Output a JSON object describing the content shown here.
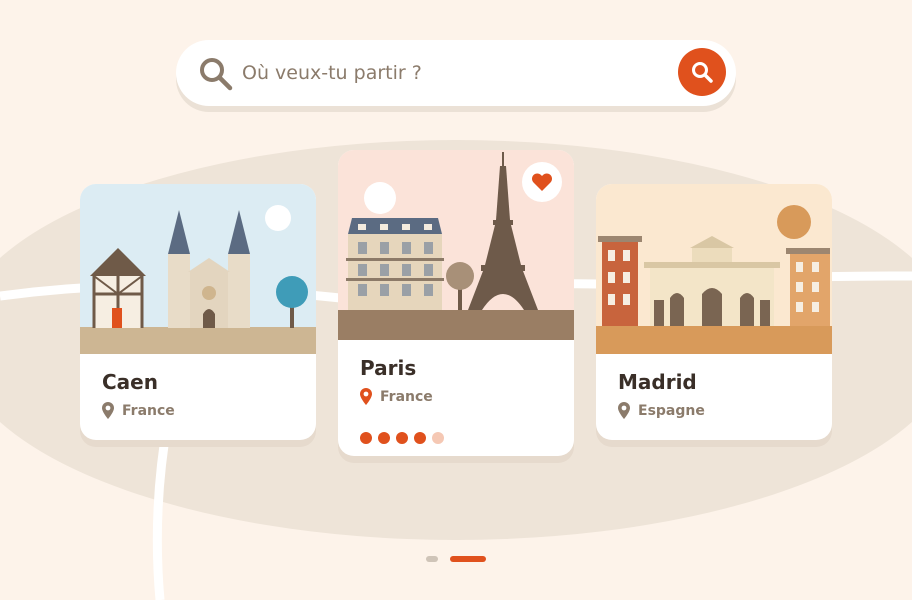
{
  "search": {
    "placeholder": "Où veux-tu partir ?",
    "value": ""
  },
  "cards": [
    {
      "city": "Caen",
      "country": "France",
      "sky_color": "#dcecf3",
      "pin_color": "#8b7b6b"
    },
    {
      "city": "Paris",
      "country": "France",
      "sky_color": "#fbe3d9",
      "pin_color": "#e0511d",
      "favorited": true,
      "image_count": 5,
      "active_image_index": 3
    },
    {
      "city": "Madrid",
      "country": "Espagne",
      "sky_color": "#fbe8d0",
      "pin_color": "#8b7b6b"
    }
  ],
  "pagination": {
    "pages": 2,
    "active_page": 2
  },
  "colors": {
    "accent": "#e0511d",
    "background": "#fdf3ea",
    "map_shape": "#eee4d8",
    "text_dark": "#3a2f28",
    "text_muted": "#8b7b6b"
  },
  "icons": [
    "search-icon",
    "search-button-icon",
    "location-pin-icon",
    "heart-icon"
  ]
}
